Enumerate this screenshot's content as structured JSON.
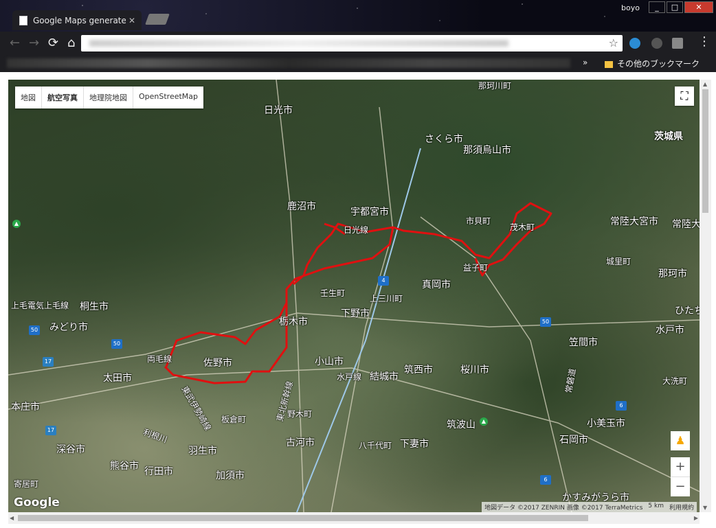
{
  "window": {
    "tab_title": "Google Maps generate",
    "user": "boyo",
    "buttons": [
      "_",
      "□",
      "✕"
    ]
  },
  "toolbar": {
    "back": "←",
    "forward": "→",
    "reload": "⟳",
    "home": "⌂",
    "bookmark_star": "☆"
  },
  "bookmarks": {
    "more": "»",
    "other_folder": "その他のブックマーク"
  },
  "map": {
    "map_types": [
      "地図",
      "航空写真",
      "地理院地図",
      "OpenStreetMap"
    ],
    "logo": "Google",
    "attribution": "地図データ ©2017 ZENRIN 画像 ©2017 TerraMetrics",
    "scale": "5 km",
    "terms": "利用規約",
    "zoom_in": "+",
    "zoom_out": "−",
    "labels": [
      "日光市",
      "さくら市",
      "那須烏山市",
      "那珂川町",
      "茨城県",
      "鹿沼市",
      "宇都宮市",
      "日光線",
      "市貝町",
      "茂木町",
      "常陸大宮市",
      "常陸大",
      "益子町",
      "城里町",
      "那珂市",
      "真岡市",
      "壬生町",
      "上三川町",
      "桐生市",
      "みどり市",
      "栃木市",
      "下野市",
      "ひたち",
      "水戸市",
      "両毛線",
      "佐野市",
      "小山市",
      "筑西市",
      "桜川市",
      "笠間市",
      "太田市",
      "結城市",
      "水戸線",
      "大洗町",
      "本庄市",
      "板倉町",
      "野木町",
      "筑波山",
      "小美玉市",
      "深谷市",
      "羽生市",
      "古河市",
      "八千代町",
      "下妻市",
      "石岡市",
      "熊谷市",
      "行田市",
      "加須市",
      "寄居町",
      "かすみがうら市",
      "上毛電気上毛線",
      "東北新幹線",
      "常磐道",
      "東武伊勢崎線",
      "利根川"
    ]
  }
}
